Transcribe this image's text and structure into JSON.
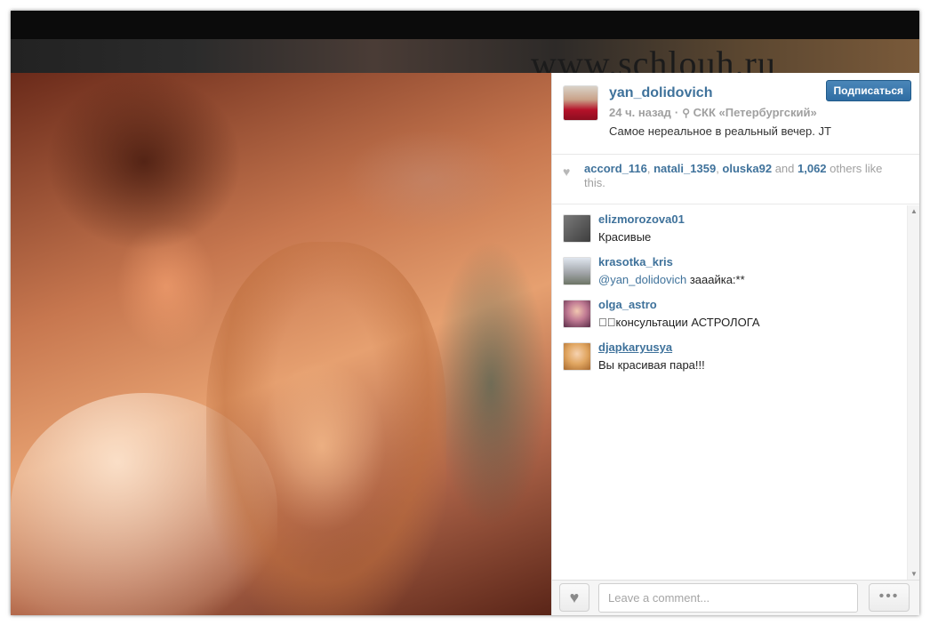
{
  "watermark": "www.schlouh.ru",
  "post": {
    "username": "yan_dolidovich",
    "time_ago": "24 ч. назад",
    "location": "СКК «Петербургский»",
    "caption": "Самое нереальное в реальный вечер. JT",
    "follow_label": "Подписаться",
    "location_icon": "map-pin-icon"
  },
  "likes": {
    "users": [
      "accord_116",
      "natali_1359",
      "oluska92"
    ],
    "joiner_1": ", ",
    "joiner_2": ", ",
    "and_text": " and ",
    "count": "1,062",
    "suffix": " others like this.",
    "icon": "heart-icon"
  },
  "comments": [
    {
      "user": "elizmorozova01",
      "text": "Красивые",
      "mention": "",
      "avatar_color": "#5a5a5a"
    },
    {
      "user": "krasotka_kris",
      "mention": "@yan_dolidovich",
      "text": " зааайка:**",
      "avatar_color": "#9a9ea8"
    },
    {
      "user": "olga_astro",
      "text": "􀀀􀀀консультации АСТРОЛОГА",
      "mention": "",
      "avatar_color": "#b06a8a"
    },
    {
      "user": "djapkaryusya",
      "text": "Вы красивая пара!!!",
      "mention": "",
      "avatar_color": "#d9a05a"
    }
  ],
  "footer": {
    "comment_placeholder": "Leave a comment...",
    "more_label": "•••",
    "like_icon": "heart-icon"
  }
}
